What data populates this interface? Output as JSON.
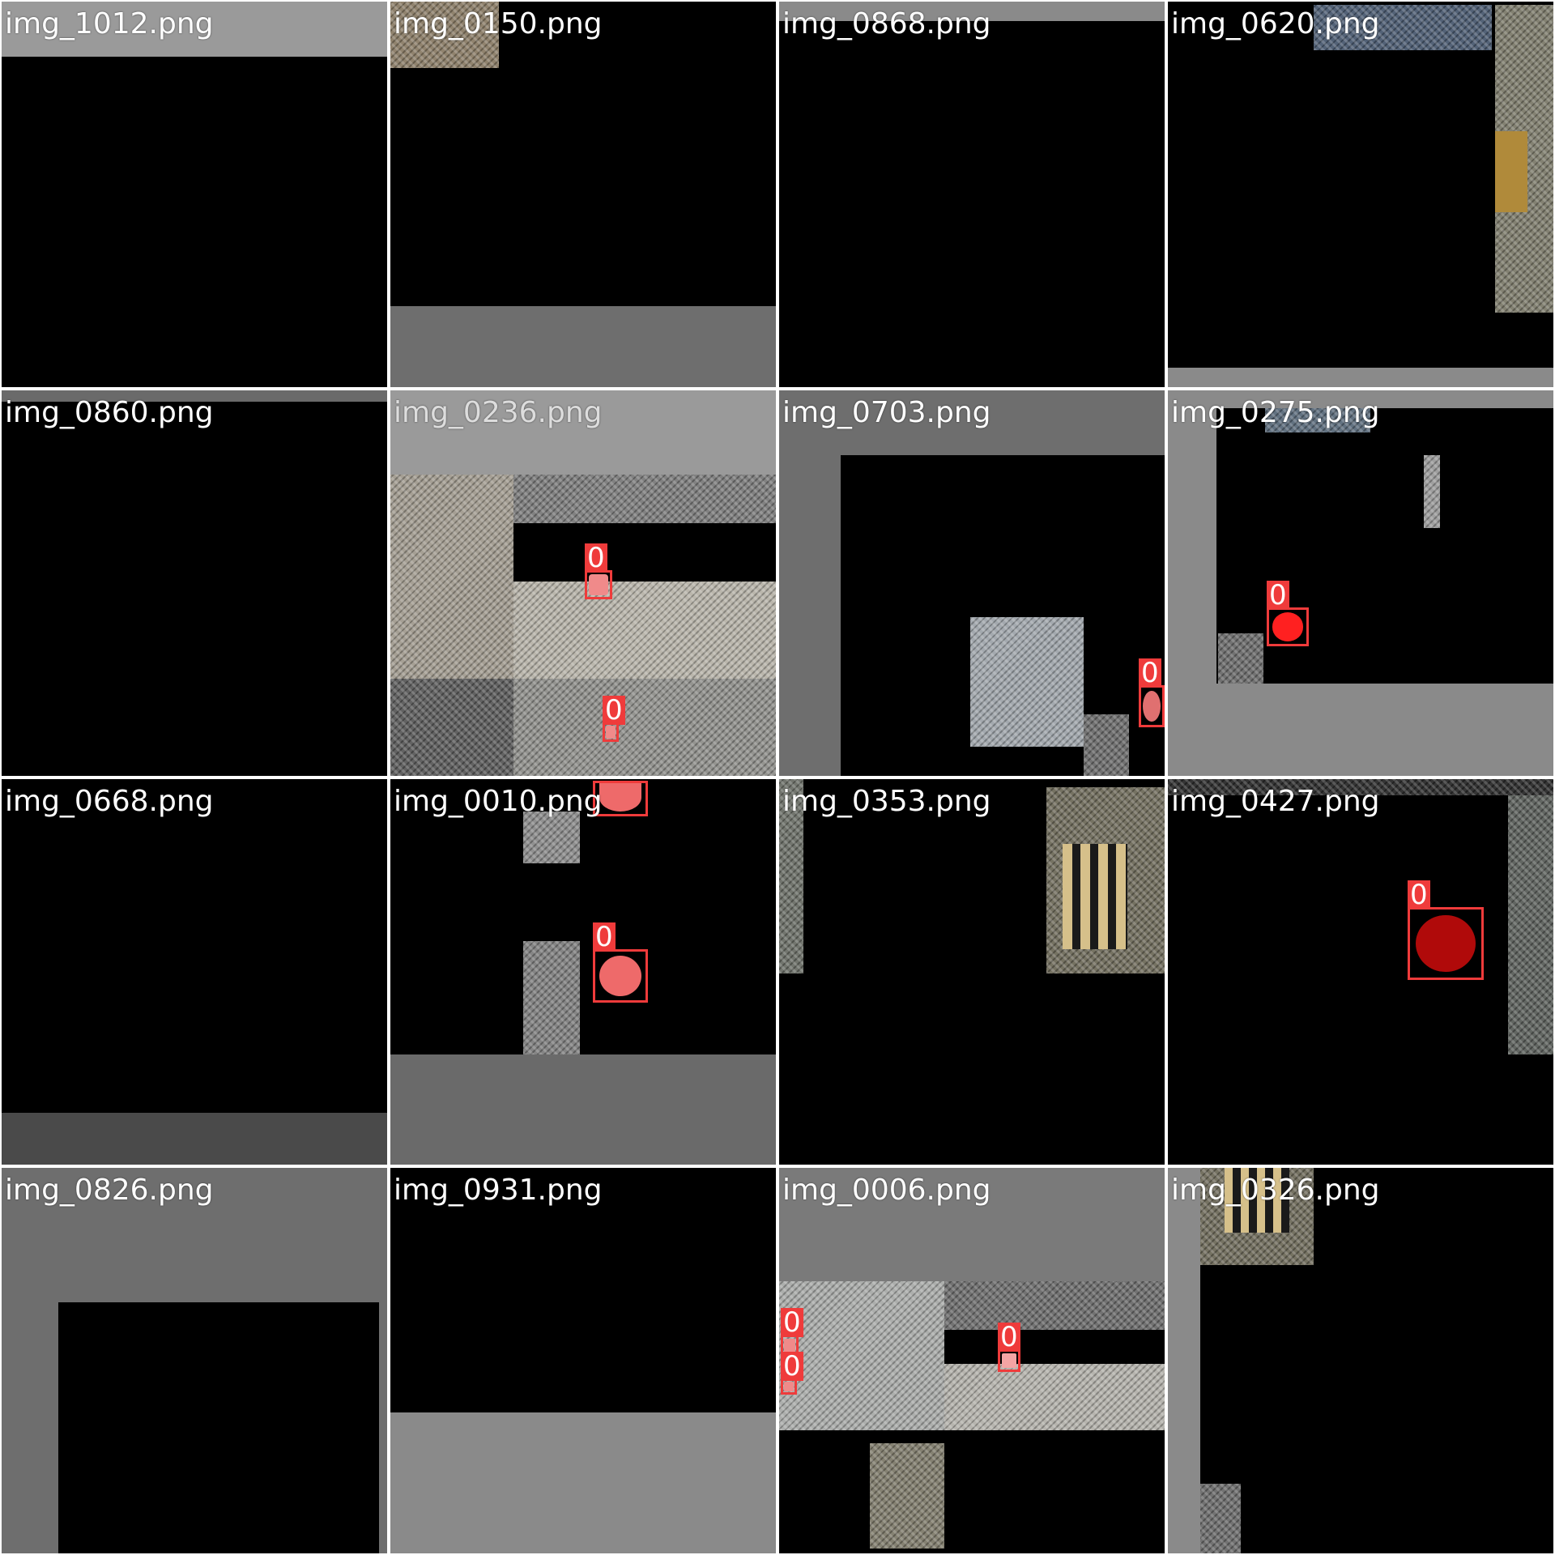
{
  "mosaic": {
    "tiles": [
      {
        "name": "img_1012.png"
      },
      {
        "name": "img_0150.png"
      },
      {
        "name": "img_0868.png"
      },
      {
        "name": "img_0620.png"
      },
      {
        "name": "img_0860.png"
      },
      {
        "name": "img_0236.png"
      },
      {
        "name": "img_0703.png"
      },
      {
        "name": "img_0275.png"
      },
      {
        "name": "img_0668.png"
      },
      {
        "name": "img_0010.png"
      },
      {
        "name": "img_0353.png"
      },
      {
        "name": "img_0427.png"
      },
      {
        "name": "img_0826.png"
      },
      {
        "name": "img_0931.png"
      },
      {
        "name": "img_0006.png"
      },
      {
        "name": "img_0326.png"
      }
    ],
    "detection_label": "0",
    "colors": {
      "box": "#ef3b3b",
      "gray_light": "#9a9a9a",
      "gray_mid": "#7a7a7a",
      "gray_dark": "#5a5a5a"
    }
  }
}
